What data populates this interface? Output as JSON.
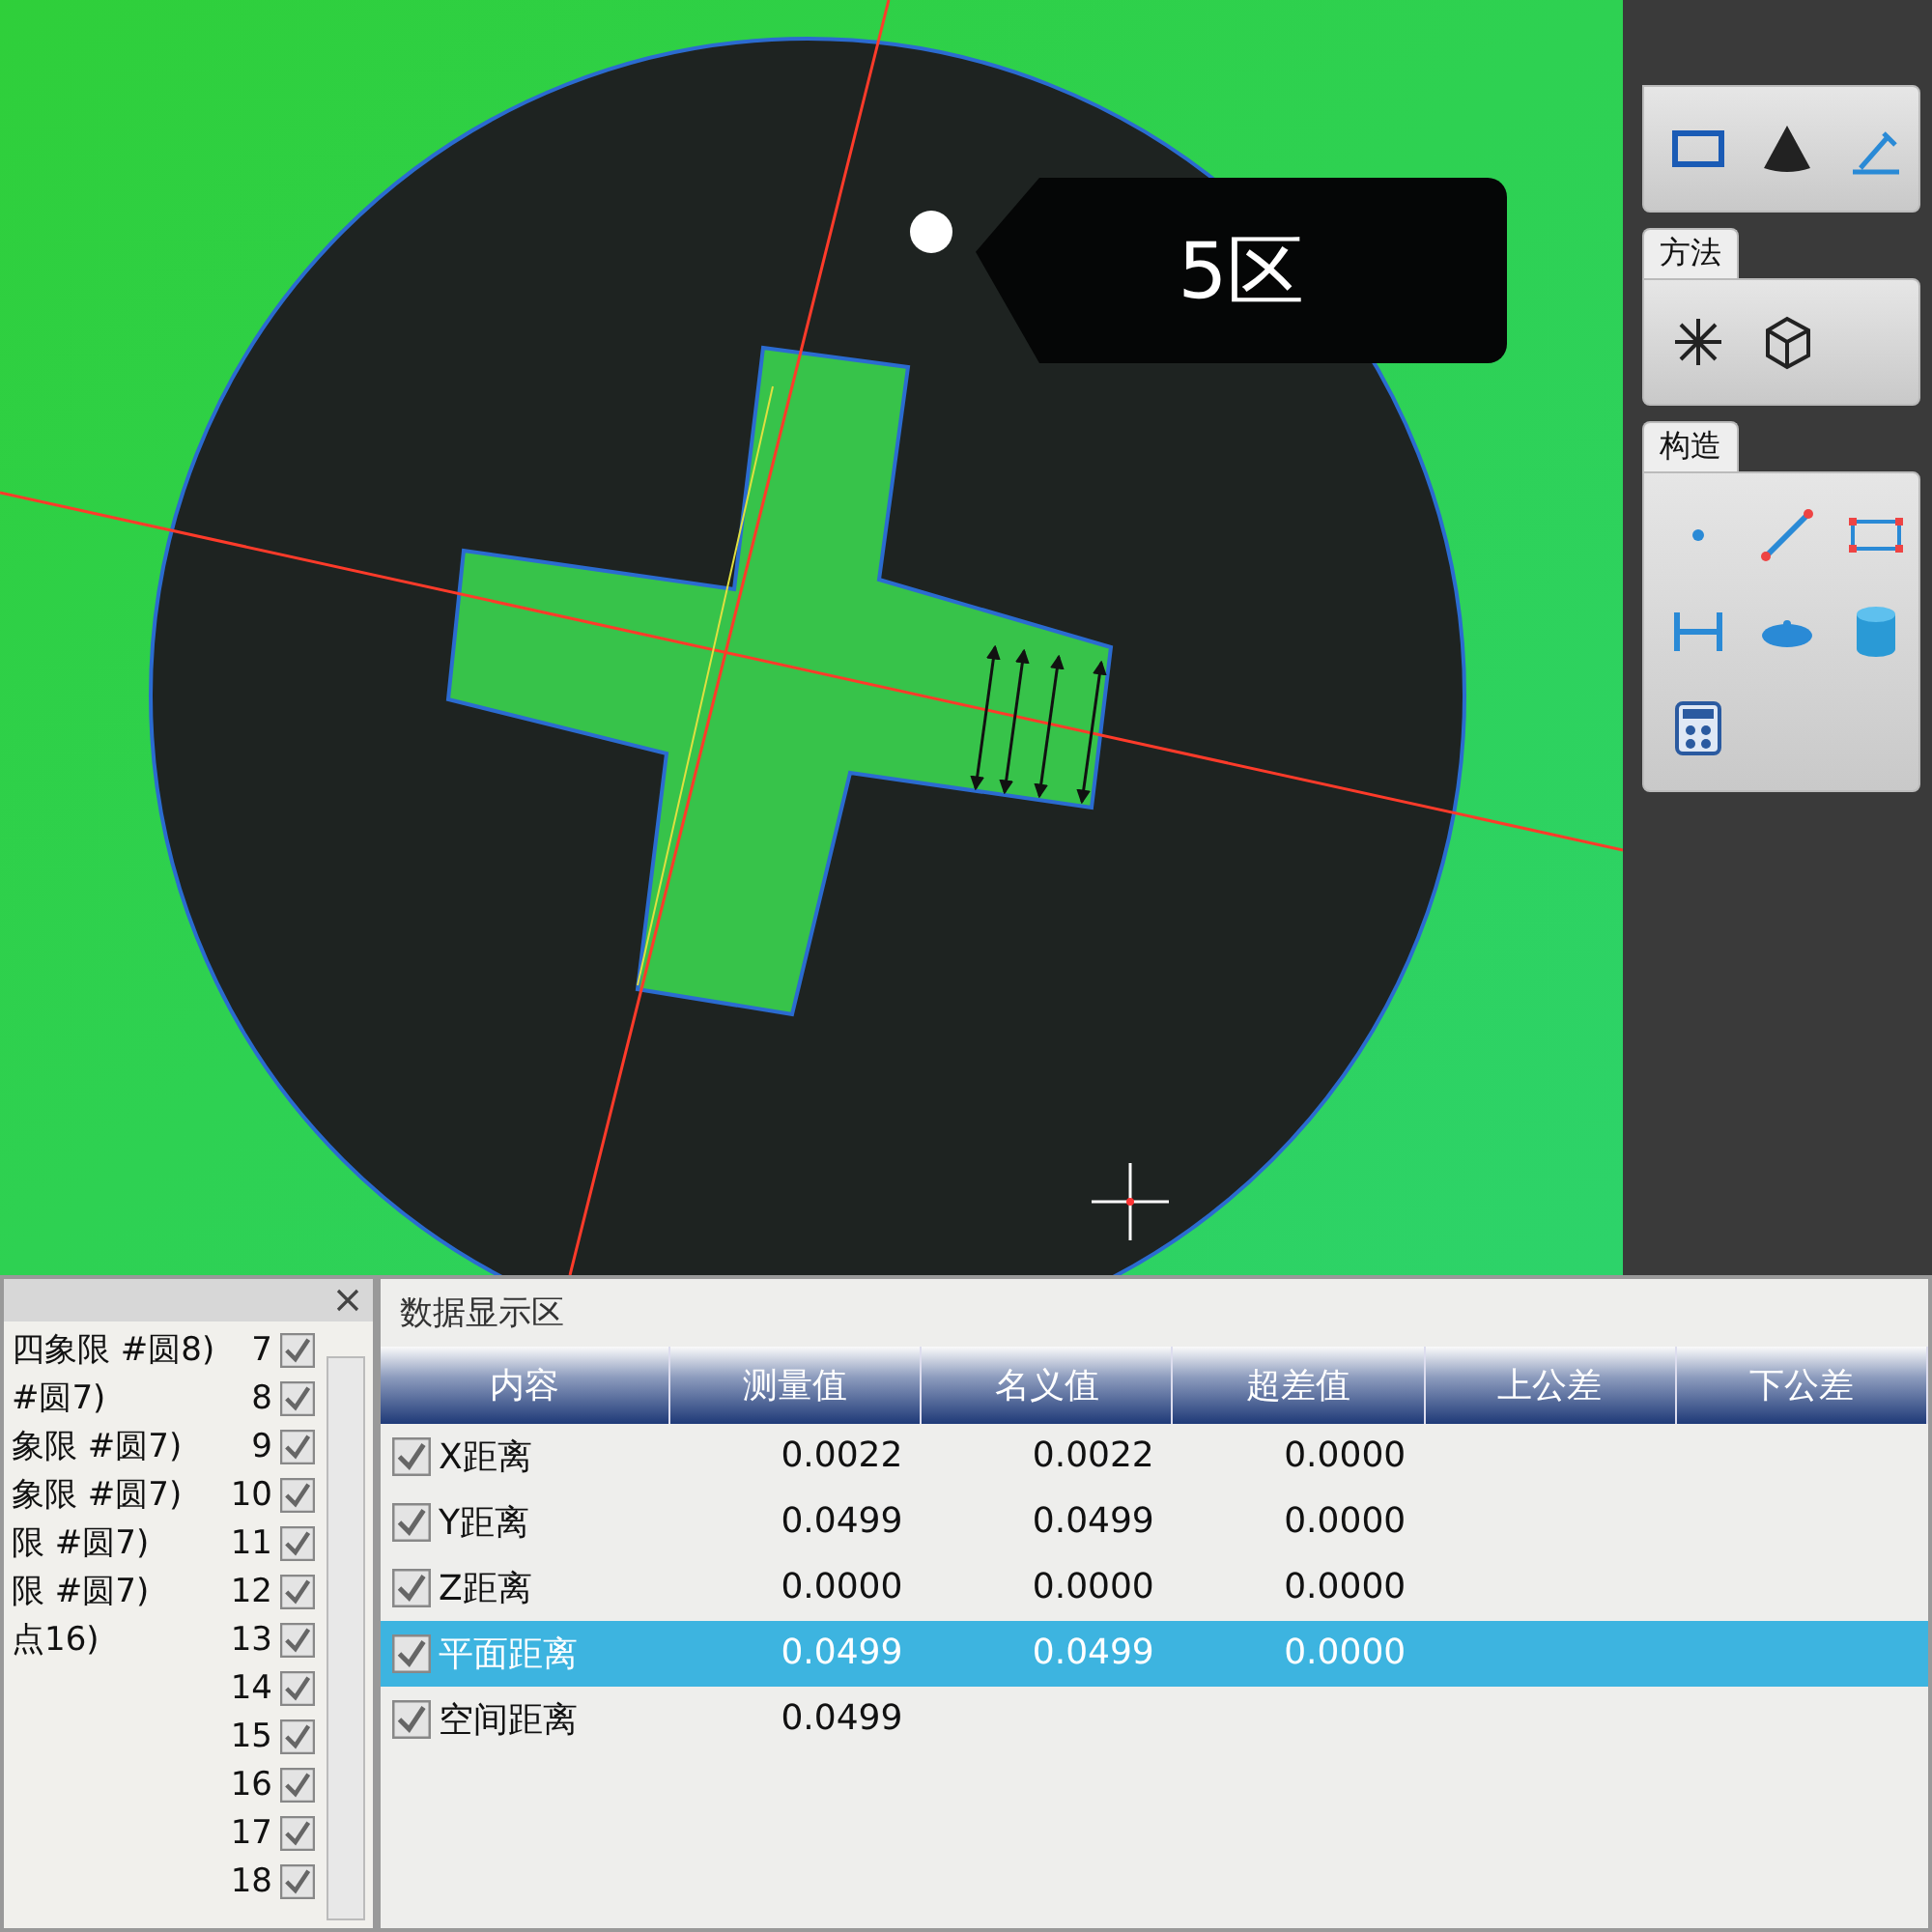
{
  "canvas": {
    "tag_label": "5区"
  },
  "tool_panel": {
    "groups": [
      {
        "tools": [
          {
            "kind": "rectangle"
          },
          {
            "kind": "cone"
          },
          {
            "kind": "probe"
          }
        ]
      },
      {
        "title": "方法",
        "tools": [
          {
            "kind": "burst"
          },
          {
            "kind": "cube"
          }
        ]
      },
      {
        "title": "构造",
        "tools": [
          {
            "kind": "point"
          },
          {
            "kind": "line"
          },
          {
            "kind": "box"
          },
          {
            "kind": "dimension"
          },
          {
            "kind": "disc"
          },
          {
            "kind": "cylinder"
          },
          {
            "kind": "calculator"
          }
        ]
      }
    ]
  },
  "feature_list": {
    "items": [
      {
        "text": "四象限 #圆8)",
        "number": "7",
        "checked": true
      },
      {
        "text": "#圆7)",
        "number": "8",
        "checked": true
      },
      {
        "text": "象限 #圆7)",
        "number": "9",
        "checked": true
      },
      {
        "text": "象限 #圆7)",
        "number": "10",
        "checked": true
      },
      {
        "text": "限 #圆7)",
        "number": "11",
        "checked": true
      },
      {
        "text": "限 #圆7)",
        "number": "12",
        "checked": true
      },
      {
        "text": "点16)",
        "number": "13",
        "checked": true
      },
      {
        "number": "14",
        "checked": true
      },
      {
        "number": "15",
        "checked": true
      },
      {
        "number": "16",
        "checked": true
      },
      {
        "number": "17",
        "checked": true
      },
      {
        "number": "18",
        "checked": true
      }
    ]
  },
  "data_panel": {
    "title": "数据显示区",
    "columns": [
      "内容",
      "测量值",
      "名义值",
      "超差值",
      "上公差",
      "下公差"
    ],
    "rows": [
      {
        "checked": true,
        "selected": false,
        "cells": [
          "X距离",
          "0.0022",
          "0.0022",
          "0.0000"
        ]
      },
      {
        "checked": true,
        "selected": false,
        "cells": [
          "Y距离",
          "0.0499",
          "0.0499",
          "0.0000"
        ]
      },
      {
        "checked": true,
        "selected": false,
        "cells": [
          "Z距离",
          "0.0000",
          "0.0000",
          "0.0000"
        ]
      },
      {
        "checked": true,
        "selected": true,
        "cells": [
          "平面距离",
          "0.0499",
          "0.0499",
          "0.0000"
        ]
      },
      {
        "checked": true,
        "selected": false,
        "cells": [
          "空间距离",
          "0.0499"
        ]
      }
    ]
  }
}
